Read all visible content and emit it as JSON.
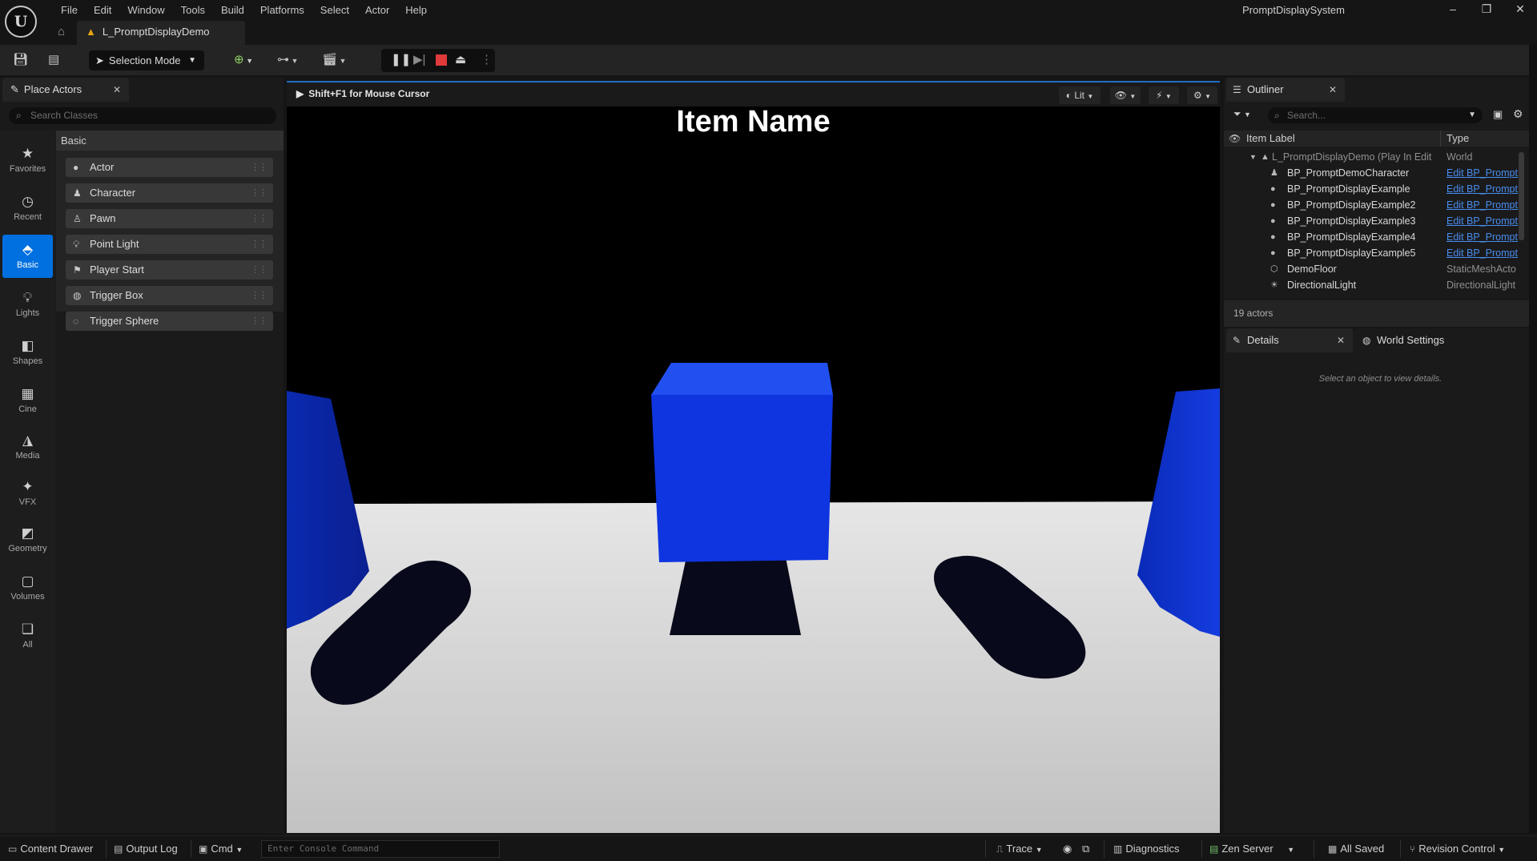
{
  "app": {
    "project_name": "PromptDisplaySystem",
    "level_tab": "L_PromptDisplayDemo",
    "menu": [
      "File",
      "Edit",
      "Window",
      "Tools",
      "Build",
      "Platforms",
      "Select",
      "Actor",
      "Help"
    ]
  },
  "toolbar": {
    "mode_label": "Selection Mode"
  },
  "place_actors": {
    "tab_label": "Place Actors",
    "search_placeholder": "Search Classes",
    "section_header": "Basic",
    "categories": [
      {
        "label": "Favorites",
        "icon": "star-icon"
      },
      {
        "label": "Recent",
        "icon": "clock-icon"
      },
      {
        "label": "Basic",
        "icon": "basic-shapes-icon"
      },
      {
        "label": "Lights",
        "icon": "lightbulb-icon"
      },
      {
        "label": "Shapes",
        "icon": "shapes-icon"
      },
      {
        "label": "Cine",
        "icon": "clapperboard-icon"
      },
      {
        "label": "Media",
        "icon": "media-icon"
      },
      {
        "label": "VFX",
        "icon": "sparkles-icon"
      },
      {
        "label": "Geometry",
        "icon": "geometry-icon"
      },
      {
        "label": "Volumes",
        "icon": "volume-icon"
      },
      {
        "label": "All",
        "icon": "all-icon"
      }
    ],
    "active_category": "Basic",
    "actors": [
      "Actor",
      "Character",
      "Pawn",
      "Point Light",
      "Player Start",
      "Trigger Box",
      "Trigger Sphere"
    ]
  },
  "viewport": {
    "hint": "Shift+F1 for Mouse Cursor",
    "view_mode": "Lit",
    "overlay_text": "Item Name"
  },
  "outliner": {
    "tab_label": "Outliner",
    "search_placeholder": "Search...",
    "col_label": "Item Label",
    "col_type": "Type",
    "rows": [
      {
        "label": "L_PromptDisplayDemo (Play In Edit",
        "type": "World",
        "link": false
      },
      {
        "label": "BP_PromptDemoCharacter",
        "type": "Edit BP_Prompt",
        "link": true
      },
      {
        "label": "BP_PromptDisplayExample",
        "type": "Edit BP_Prompt",
        "link": true
      },
      {
        "label": "BP_PromptDisplayExample2",
        "type": "Edit BP_Prompt",
        "link": true
      },
      {
        "label": "BP_PromptDisplayExample3",
        "type": "Edit BP_Prompt",
        "link": true
      },
      {
        "label": "BP_PromptDisplayExample4",
        "type": "Edit BP_Prompt",
        "link": true
      },
      {
        "label": "BP_PromptDisplayExample5",
        "type": "Edit BP_Prompt",
        "link": true
      },
      {
        "label": "DemoFloor",
        "type": "StaticMeshActo",
        "link": false
      },
      {
        "label": "DirectionalLight",
        "type": "DirectionalLight",
        "link": false
      }
    ],
    "footer": "19 actors"
  },
  "details": {
    "tab_label": "Details",
    "world_settings_label": "World Settings",
    "empty_text": "Select an object to view details."
  },
  "statusbar": {
    "content_drawer": "Content Drawer",
    "output_log": "Output Log",
    "cmd": "Cmd",
    "console_placeholder": "Enter Console Command",
    "trace": "Trace",
    "diagnostics": "Diagnostics",
    "zen_server": "Zen Server",
    "all_saved": "All Saved",
    "revision_control": "Revision Control"
  },
  "colors": {
    "accent": "#0070e0",
    "stop_red": "#e03a3a",
    "warning": "#e6a417",
    "link": "#4a8cf0",
    "scene_blue": "#1238d8"
  }
}
